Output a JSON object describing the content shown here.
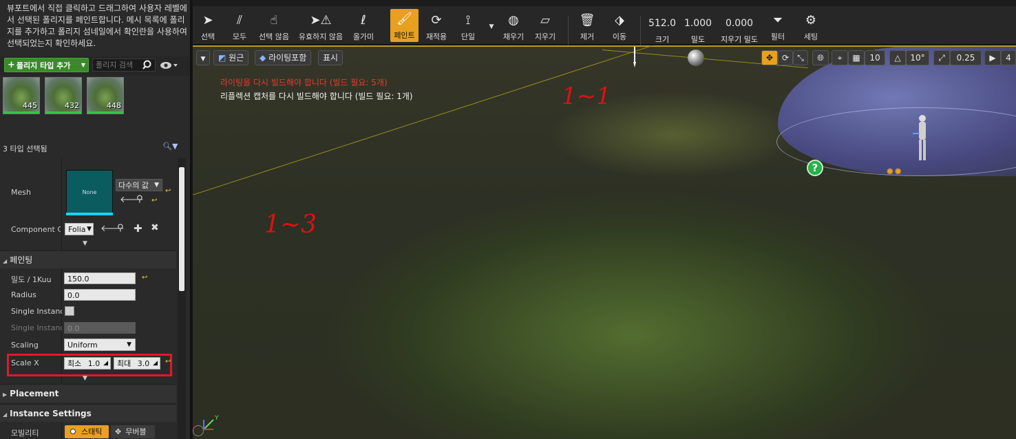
{
  "left_panel": {
    "instructions": "뷰포트에서 직접 클릭하고 드래그하여 사용자 레벨에서 선택된 폴리지를 페인트합니다. 메시 목록에 폴리지를 추가하고 폴리지 섬네일에서 확인란을 사용하여 선택되었는지 확인하세요.",
    "add_type_label": "폴리지 타입 추가",
    "search_placeholder": "폴리지 검색",
    "thumbnails": [
      {
        "count": "445"
      },
      {
        "count": "432"
      },
      {
        "count": "448"
      }
    ],
    "selected_count": "3 타입 선택됨",
    "mesh": {
      "label": "Mesh",
      "value": "None",
      "combo": "다수의 값"
    },
    "component_class": {
      "label": "Component Cla",
      "value": "Folia"
    },
    "painting": {
      "title": "페인팅",
      "density": {
        "label": "밀도 / 1Kuu",
        "value": "150.0"
      },
      "radius": {
        "label": "Radius",
        "value": "0.0"
      },
      "single_instance": {
        "label": "Single Instance"
      },
      "single_instance2": {
        "label": "Single Instanc",
        "value": "0.0"
      },
      "scaling": {
        "label": "Scaling",
        "value": "Uniform"
      },
      "scale_x": {
        "label": "Scale X",
        "min_label": "최소",
        "min_value": "1.0",
        "max_label": "최대",
        "max_value": "3.0"
      }
    },
    "placement": {
      "title": "Placement"
    },
    "instance_settings": {
      "title": "Instance Settings"
    },
    "mobility": {
      "label": "모빌리티",
      "static": "스태틱",
      "movable": "무버블"
    }
  },
  "toolbar": {
    "tools": [
      {
        "label": "선택"
      },
      {
        "label": "모두"
      },
      {
        "label": "선택 않음"
      },
      {
        "label": "유효하지 않음"
      },
      {
        "label": "올가미"
      },
      {
        "label": "페인트"
      },
      {
        "label": "재적용"
      },
      {
        "label": "단일"
      },
      {
        "label": "채우기"
      },
      {
        "label": "지우기"
      },
      {
        "label": "제거"
      },
      {
        "label": "이동"
      }
    ],
    "size": {
      "value": "512.0",
      "label": "크기"
    },
    "density": {
      "value": "1.000",
      "label": "밀도"
    },
    "erase_density": {
      "value": "0.000",
      "label": "지우기 밀도"
    },
    "filter": {
      "label": "필터"
    },
    "settings": {
      "label": "세팅"
    }
  },
  "viewport": {
    "perspective": "원근",
    "lighting": "라이팅포함",
    "show": "표시",
    "grid_snap": "10",
    "rotation_snap": "10°",
    "scale_snap": "0.25",
    "camera_speed": "4",
    "warning_lighting": "라이팅을 다시 빌드해야 합니다 (빌드 필요: 5개)",
    "warning_reflection": "리플렉션 캡처를 다시 빌드해야 합니다 (빌드 필요: 1개)",
    "annotation_top": "1~1",
    "annotation_main": "1~3",
    "help_icon": "?"
  },
  "colors": {
    "accent": "#e8a020",
    "add_button": "#3a8a2a",
    "highlight_box": "#e0192a",
    "warning": "#e63a2a"
  }
}
